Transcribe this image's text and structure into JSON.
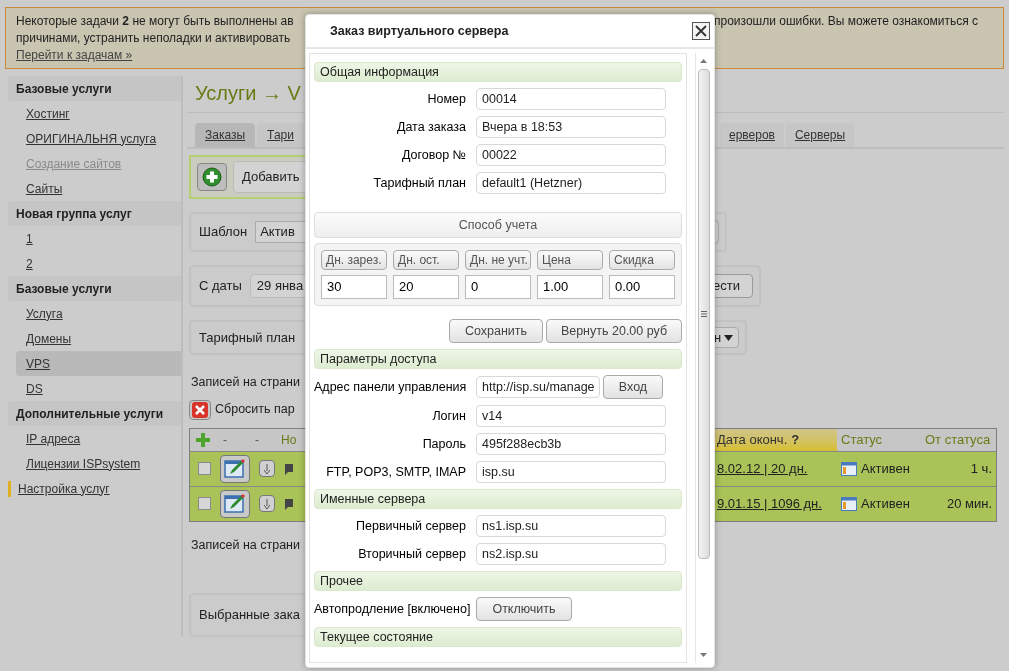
{
  "alert": {
    "text_left": "Некоторые задачи **2** не могут быть выполнены ав",
    "text_right": "произошли ошибки. Вы можете ознакомиться с",
    "line2": "причинами, устранить неполадки и активировать",
    "link": "Перейти к задачам »"
  },
  "sidebar": {
    "groups": [
      {
        "title": "Базовые услуги",
        "items": [
          {
            "label": "Хостинг",
            "selected": false,
            "disabled": false
          },
          {
            "label": "ОРИГИНАЛЬНЯ услуга",
            "selected": false,
            "disabled": false
          },
          {
            "label": "Создание сайтов",
            "selected": false,
            "disabled": true
          },
          {
            "label": "Сайты",
            "selected": false,
            "disabled": false
          }
        ]
      },
      {
        "title": "Новая группа услуг",
        "items": [
          {
            "label": "1",
            "selected": false,
            "disabled": false
          },
          {
            "label": "2",
            "selected": false,
            "disabled": false
          }
        ]
      },
      {
        "title": "Базовые услуги",
        "items": [
          {
            "label": "Услуга",
            "selected": false,
            "disabled": false
          },
          {
            "label": "Домены",
            "selected": false,
            "disabled": false
          },
          {
            "label": "VPS",
            "selected": true,
            "disabled": false
          },
          {
            "label": "DS",
            "selected": false,
            "disabled": false
          }
        ]
      },
      {
        "title": "Дополнительные услуги",
        "items": [
          {
            "label": "IP адреса",
            "selected": false,
            "disabled": false
          },
          {
            "label": "Лицензии ISPsystem",
            "selected": false,
            "disabled": false
          }
        ]
      }
    ],
    "settings_link": "Настройка услуг"
  },
  "page": {
    "title": "Услуги → V",
    "tabs_left": [
      {
        "label": "Заказы",
        "selected": true
      },
      {
        "label": "Тари",
        "selected": false
      }
    ],
    "tabs_right": [
      {
        "label": "ерверов",
        "selected": false
      },
      {
        "label": "Серверы",
        "selected": false
      }
    ],
    "add_button": "Добавить",
    "template_filter": {
      "label": "Шаблон",
      "value": "Актив"
    },
    "date_filter": {
      "label": "С даты",
      "value": "29 янва",
      "button": "ести"
    },
    "plan_filter": {
      "label": "Тарифный план",
      "value": "н"
    },
    "per_page_top": "Записей на страни",
    "reset_button": "Сбросить пар",
    "table": {
      "columns_left": [
        "-",
        "-",
        "Но"
      ],
      "columns_right": [
        {
          "label": "Дата оконч.",
          "help": "?",
          "sorted": true
        },
        {
          "label": "Статус",
          "sorted": false
        },
        {
          "label": "От статуса",
          "sorted": false
        }
      ],
      "rows": [
        {
          "checked": false,
          "end_date": "8.02.12 | 20 дн.",
          "status": "Активен",
          "since": "1 ч."
        },
        {
          "checked": false,
          "end_date": "9.01.15 | 1096 дн.",
          "status": "Активен",
          "since": "20 мин."
        }
      ]
    },
    "per_page_bottom": "Записей на страни",
    "selected_panel": "Выбранные зака"
  },
  "dialog": {
    "title": "Заказ виртуального сервера",
    "sections": [
      {
        "title": "Общая информация",
        "rows": [
          {
            "kind": "field",
            "label": "Номер",
            "value": "00014"
          },
          {
            "kind": "field",
            "label": "Дата заказа",
            "value": "Вчера в 18:53"
          },
          {
            "kind": "field",
            "label": "Договор №",
            "value": "00022"
          },
          {
            "kind": "field",
            "label": "Тарифный план",
            "value": "default1 (Hetzner)"
          },
          {
            "kind": "billing",
            "title": "Способ учета",
            "columns": [
              {
                "label": "Дн. зарез.",
                "value": "30"
              },
              {
                "label": "Дн. ост.",
                "value": "20"
              },
              {
                "label": "Дн. не учт.",
                "value": "0"
              },
              {
                "label": "Цена",
                "value": "1.00"
              },
              {
                "label": "Скидка",
                "value": "0.00"
              }
            ],
            "buttons": [
              "Сохранить",
              "Вернуть 20.00 руб"
            ]
          }
        ]
      },
      {
        "title": "Параметры доступа",
        "rows": [
          {
            "kind": "field-button",
            "label": "Адрес панели управления",
            "value": "http://isp.su/manage",
            "button": "Вход"
          },
          {
            "kind": "field",
            "label": "Логин",
            "value": "v14"
          },
          {
            "kind": "field",
            "label": "Пароль",
            "value": "495f288ecb3b"
          },
          {
            "kind": "field",
            "label": "FTP, POP3, SMTP, IMAP",
            "value": "isp.su"
          }
        ]
      },
      {
        "title": "Именные сервера",
        "rows": [
          {
            "kind": "field",
            "label": "Первичный сервер",
            "value": "ns1.isp.su"
          },
          {
            "kind": "field",
            "label": "Вторичный сервер",
            "value": "ns2.isp.su"
          }
        ]
      },
      {
        "title": "Прочее",
        "rows": [
          {
            "kind": "button",
            "label": "Автопродление [включено]",
            "button": "Отключить"
          }
        ]
      },
      {
        "title": "Текущее состояние"
      }
    ]
  }
}
